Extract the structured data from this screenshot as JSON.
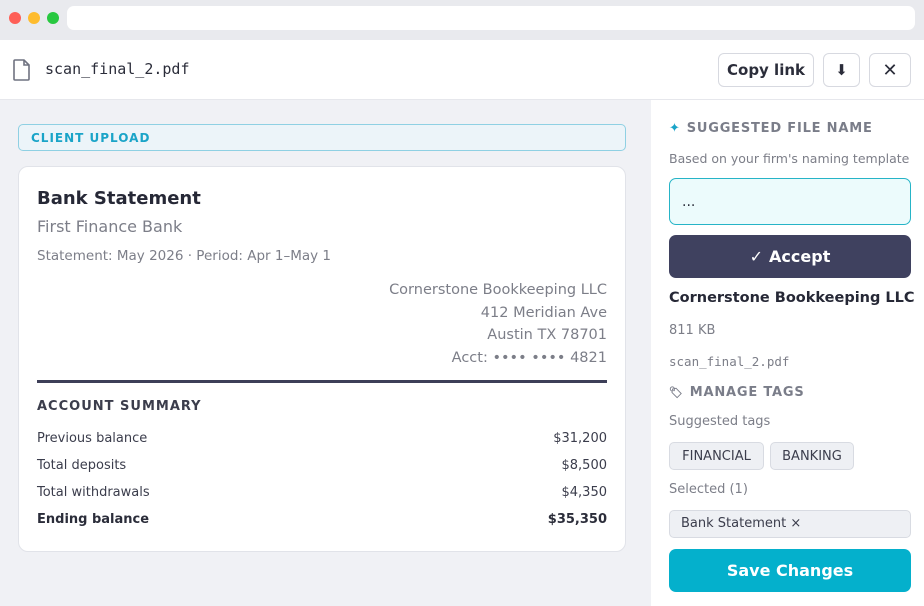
{
  "window": {
    "url": ""
  },
  "header": {
    "file_icon": "document-icon",
    "filename": "scan_final_2.pdf",
    "copy_link_label": "Copy link",
    "download_icon": "download-icon",
    "close_icon": "close-icon",
    "download_glyph": "⬇",
    "close_glyph": "✕"
  },
  "document": {
    "tag": "CLIENT UPLOAD",
    "title": "Bank Statement",
    "bank": "First Finance Bank",
    "period": "Statement: May 2026 · Period: Apr 1–May 1",
    "address_lines": [
      "Cornerstone Bookkeeping LLC",
      "412 Meridian Ave",
      "Austin TX 78701",
      "Acct: •••• •••• 4821"
    ],
    "summary_heading": "ACCOUNT SUMMARY",
    "summary_rows": [
      {
        "label": "Previous balance",
        "value": "$31,200"
      },
      {
        "label": "Total deposits",
        "value": "$8,500"
      },
      {
        "label": "Total withdrawals",
        "value": "$4,350"
      },
      {
        "label": "Ending balance",
        "value": "$35,350"
      }
    ]
  },
  "sidebar": {
    "suggested_heading": "SUGGESTED FILE NAME",
    "suggested_icon": "sparkle-icon",
    "suggested_glyph": "✦",
    "hint": "Based on your firm's naming template",
    "suggested_value": "...",
    "accept_label": "Accept",
    "accept_glyph": "✓",
    "entity": "Cornerstone Bookkeeping LLC",
    "file_size": "811 KB",
    "original_filename": "scan_final_2.pdf",
    "tags_heading": "MANAGE TAGS",
    "tags_icon": "tag-icon",
    "tags_glyph": "🏷",
    "suggested_tags_label": "Suggested tags",
    "suggested_tags": [
      "FINANCIAL",
      "BANKING"
    ],
    "selected_label": "Selected (1)",
    "selected_tag": "Bank Statement ×",
    "save_label": "Save Changes"
  },
  "colors": {
    "accent": "#04b0cc",
    "dark_button": "#3f415f"
  }
}
